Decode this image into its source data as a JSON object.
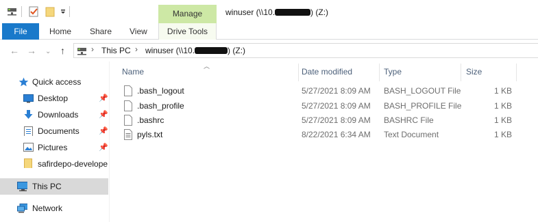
{
  "titlebar": {
    "manage_label": "Manage",
    "title_prefix": "winuser (\\\\10.",
    "title_suffix": ") (Z:)"
  },
  "ribbon": {
    "file_label": "File",
    "tabs": [
      "Home",
      "Share",
      "View"
    ],
    "drive_tools_label": "Drive Tools",
    "accent": "#1979ca",
    "manage_color": "#cde8a5"
  },
  "address": {
    "crumbs": [
      "This PC",
      "winuser (\\\\10."
    ],
    "crumb_suffix": ") (Z:)",
    "separator": "›"
  },
  "sidebar": {
    "quick_access": "Quick access",
    "items": [
      {
        "label": "Desktop",
        "icon": "desktop-icon",
        "pinned": true
      },
      {
        "label": "Downloads",
        "icon": "downloads-icon",
        "pinned": true
      },
      {
        "label": "Documents",
        "icon": "documents-icon",
        "pinned": true
      },
      {
        "label": "Pictures",
        "icon": "pictures-icon",
        "pinned": true
      },
      {
        "label": "safirdepo-develope",
        "icon": "folder-icon",
        "pinned": false
      }
    ],
    "this_pc": "This PC",
    "network": "Network"
  },
  "columns": {
    "name": "Name",
    "date": "Date modified",
    "type": "Type",
    "size": "Size"
  },
  "files": [
    {
      "name": ".bash_logout",
      "date": "5/27/2021 8:09 AM",
      "type": "BASH_LOGOUT File",
      "size": "1 KB",
      "icon": "blank-file-icon"
    },
    {
      "name": ".bash_profile",
      "date": "5/27/2021 8:09 AM",
      "type": "BASH_PROFILE File",
      "size": "1 KB",
      "icon": "blank-file-icon"
    },
    {
      "name": ".bashrc",
      "date": "5/27/2021 8:09 AM",
      "type": "BASHRC File",
      "size": "1 KB",
      "icon": "blank-file-icon"
    },
    {
      "name": "pyls.txt",
      "date": "8/22/2021 6:34 AM",
      "type": "Text Document",
      "size": "1 KB",
      "icon": "text-file-icon"
    }
  ]
}
